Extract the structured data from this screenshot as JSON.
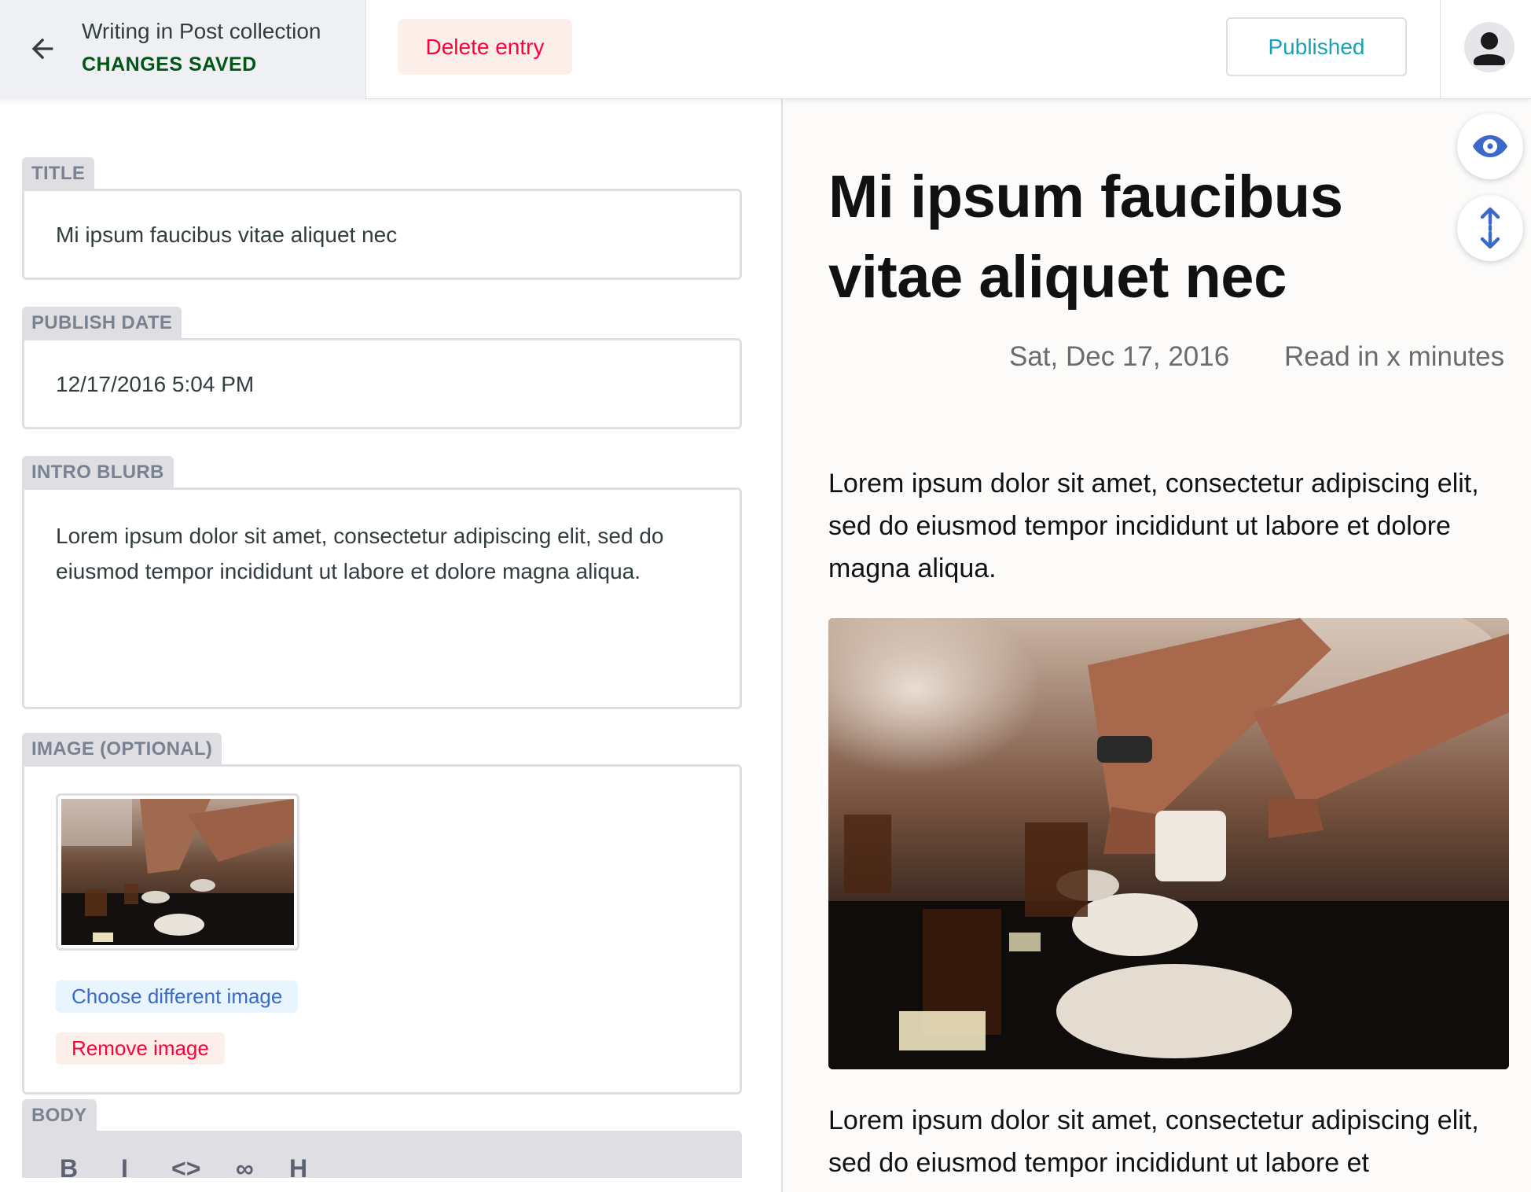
{
  "header": {
    "collection_title": "Writing in Post collection",
    "save_status": "CHANGES SAVED",
    "delete_label": "Delete entry",
    "publish_status_label": "Published"
  },
  "editor": {
    "title_label": "TITLE",
    "title_value": "Mi ipsum faucibus vitae aliquet nec",
    "date_label": "PUBLISH DATE",
    "date_value": "12/17/2016 5:04 PM",
    "blurb_label": "INTRO BLURB",
    "blurb_value": "Lorem ipsum dolor sit amet, consectetur adipiscing elit, sed do eiusmod tempor incididunt ut labore et dolore magna aliqua.",
    "image_label": "IMAGE (OPTIONAL)",
    "choose_image_label": "Choose different image",
    "remove_image_label": "Remove image",
    "body_label": "BODY"
  },
  "preview": {
    "title": "Mi ipsum faucibus vitae aliquet nec",
    "date": "Sat, Dec 17, 2016",
    "read_time": "Read in x minutes",
    "paragraph_1": "Lorem ipsum dolor sit amet, consectetur adipiscing elit, sed do eiusmod tempor incididunt ut labore et dolore magna aliqua.",
    "paragraph_2": "Lorem ipsum dolor sit amet, consectetur adipiscing elit, sed do eiusmod tempor incididunt ut labore et"
  },
  "icons": {
    "back": "arrow-left-icon",
    "avatar": "user-avatar-icon",
    "preview_toggle": "eye-icon",
    "scroll_sync": "scroll-sync-icon"
  },
  "colors": {
    "saved_green": "#005614",
    "delete_red": "#ff003b",
    "published_teal": "#17a2b8",
    "accent_blue": "#3a69c7"
  }
}
